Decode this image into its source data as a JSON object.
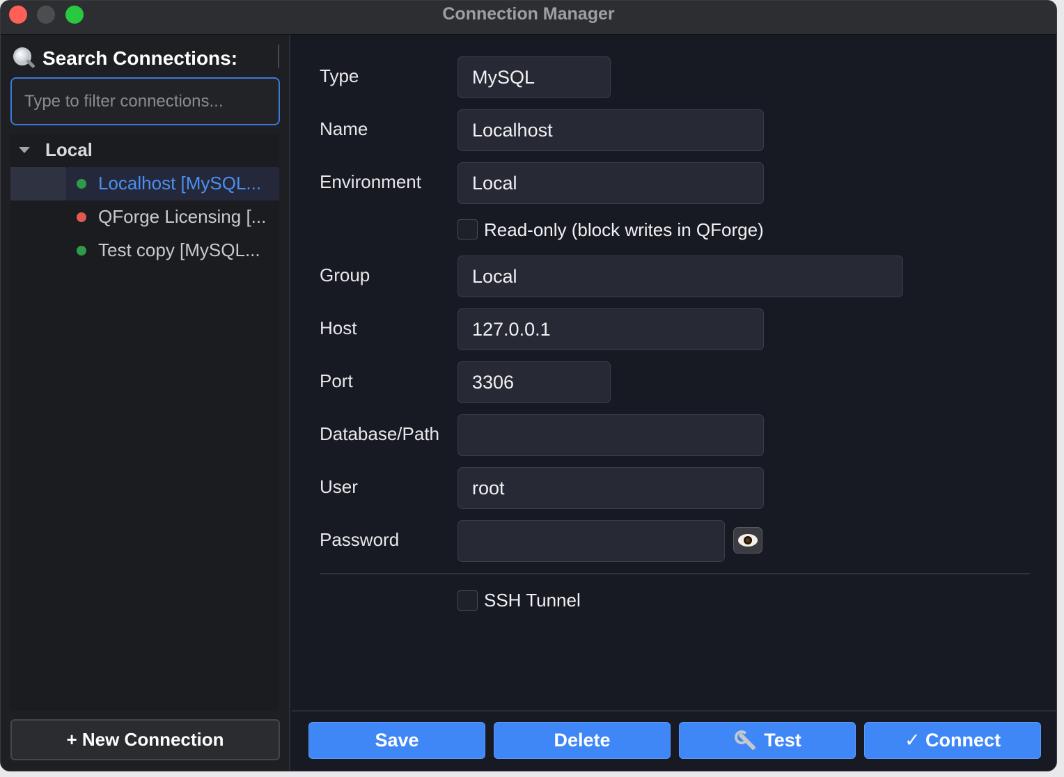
{
  "window": {
    "title": "Connection Manager"
  },
  "sidebar": {
    "search_label": "Search Connections:",
    "search_placeholder": "Type to filter connections...",
    "search_value": "",
    "group": {
      "label": "Local"
    },
    "items": [
      {
        "label": "Localhost  [MySQL...",
        "status_color": "#2e9a4a",
        "selected": true
      },
      {
        "label": "QForge Licensing  [...",
        "status_color": "#e05a52",
        "selected": false
      },
      {
        "label": "Test copy  [MySQL...",
        "status_color": "#2e9a4a",
        "selected": false
      }
    ],
    "new_connection_label": "+ New Connection"
  },
  "form": {
    "type": {
      "label": "Type",
      "value": "MySQL"
    },
    "name": {
      "label": "Name",
      "value": "Localhost"
    },
    "environment": {
      "label": "Environment",
      "value": "Local"
    },
    "readonly": {
      "label": "Read-only (block writes in QForge)",
      "checked": false
    },
    "group": {
      "label": "Group",
      "value": "Local"
    },
    "host": {
      "label": "Host",
      "value": "127.0.0.1"
    },
    "port": {
      "label": "Port",
      "value": "3306"
    },
    "database": {
      "label": "Database/Path",
      "value": ""
    },
    "user": {
      "label": "User",
      "value": "root"
    },
    "password": {
      "label": "Password",
      "value": ""
    },
    "ssh": {
      "label": "SSH Tunnel",
      "checked": false
    }
  },
  "actions": {
    "save": "Save",
    "delete": "Delete",
    "test": "Test",
    "connect": "✓ Connect",
    "accent": "#3f86f7"
  }
}
